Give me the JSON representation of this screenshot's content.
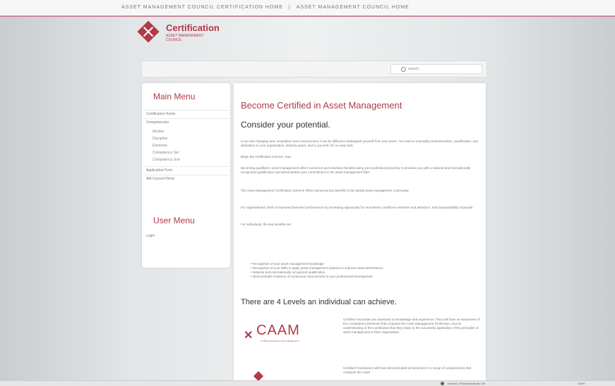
{
  "topnav": {
    "link1": "ASSET MANAGEMENT COUNCIL CERTIFICATION HOME",
    "separator": "|",
    "link2": "ASSET MANAGEMENT COUNCIL HOME"
  },
  "logo": {
    "title": "Certification",
    "subtitle": "ASSET MANAGEMENT COUNCIL"
  },
  "search": {
    "placeholder": "search"
  },
  "sidebar": {
    "main_menu_title": "Main Menu",
    "items": [
      {
        "label": "Certification Home"
      },
      {
        "label": "Competencies"
      },
      {
        "label": "Application Form"
      },
      {
        "label": "AM Council Home"
      }
    ],
    "subitems": [
      {
        "label": "Models"
      },
      {
        "label": "Discipline"
      },
      {
        "label": "Elements"
      },
      {
        "label": "Competency Set"
      },
      {
        "label": "Competency Unit"
      }
    ],
    "user_menu_title": "User Menu",
    "user_items": [
      {
        "label": "Login"
      }
    ]
  },
  "main": {
    "heading": "Become Certified in Asset Management",
    "subheading": "Consider your potential.",
    "paragraphs": [
      "In an ever changing and competitive work environment, it can be difficult to distinguish yourself from your peers. You want to exemplify professionalism, qualification, and dedication to your organisation, industry peers, and to yourself. It's no easy task.",
      "Begin the certification scheme, now.",
      "Becoming qualified in asset management offers numerous and extensive benefits along your professional journey. It provides you with a national and internationally recognised qualification and demonstrates your commitment to the asset management field.",
      "The Asset Management Certification Scheme offers numerous key benefits to the global asset management community.",
      "For organisations, there is improved business performance by increasing opportunity for recruitment, workforce retention and attraction, and transportability of people.",
      "For individuals, the key benefits are:"
    ],
    "bullets": [
      "Recognition of your asset management knowledge",
      "Recognition of your skills to apply asset management systems to improve asset performance",
      "National and internationally recognised qualification",
      "Demonstrable evidence of continuous improvement in your professional development"
    ],
    "levels_heading": "There are 4 Levels an individual can achieve.",
    "caam": {
      "logo_text": "CAAM",
      "logo_tagline": "Certified Associate in Asset Management",
      "description": "Certified Associates are assessed on knowledge and experience. They will have an awareness of the Competency Elements that comprise the Asset Management Profession, and an understanding of the contribution that they make to the successful application of the principles of asset management in their organisation."
    },
    "practitioner": {
      "description": "Certified Practitioners will have demonstrated achievement in a range of competencies that comprise the Asset"
    }
  },
  "statusbar": {
    "zone": "Internet | Protected Mode: Off",
    "zoom": "100%"
  },
  "colors": {
    "brand": "#b03a48",
    "background": "#e3e6e8"
  }
}
